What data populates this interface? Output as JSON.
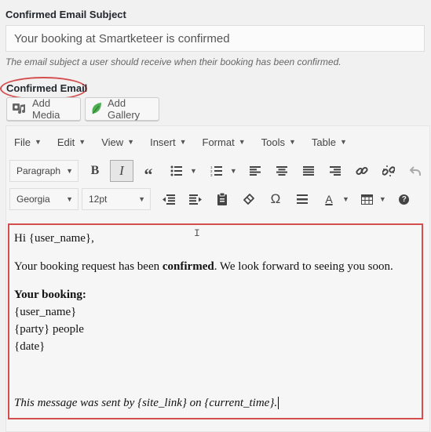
{
  "subject": {
    "label": "Confirmed Email Subject",
    "value": "Your booking at Smartketeer is confirmed",
    "description": "The email subject a user should receive when their booking has been confirmed."
  },
  "email": {
    "label": "Confirmed Email",
    "add_media": "Add Media",
    "add_gallery": "Add Gallery"
  },
  "menubar": [
    "File",
    "Edit",
    "View",
    "Insert",
    "Format",
    "Tools",
    "Table"
  ],
  "toolbar": {
    "paragraph": "Paragraph",
    "font": "Georgia",
    "size": "12pt",
    "omega": "Ω",
    "text_color_letter": "A",
    "help": "?"
  },
  "content": {
    "greeting": "Hi {user_name},",
    "line1_pre": "Your booking request has been ",
    "line1_bold": "confirmed",
    "line1_post": ". We look forward to seeing you soon.",
    "heading": "Your booking:",
    "f1": "{user_name}",
    "f2": "{party} people",
    "f3": "{date}",
    "footer": "This message was sent by {site_link} on {current_time}."
  },
  "colors": {
    "highlight": "#d54e4e",
    "gallery_leaf": "#4caf50"
  }
}
